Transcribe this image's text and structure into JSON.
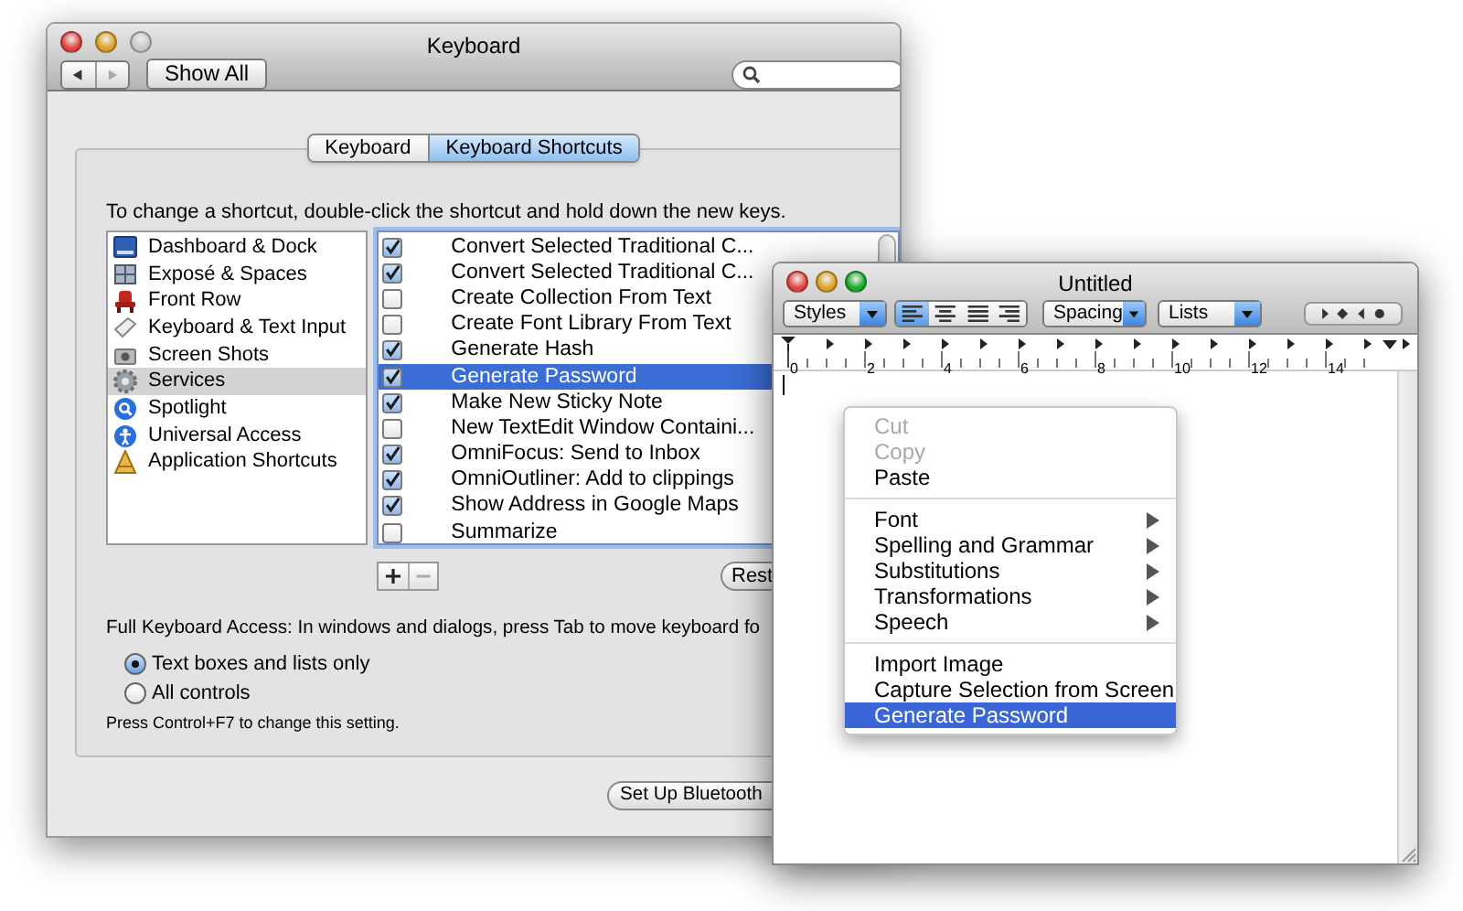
{
  "keyboard_window": {
    "title": "Keyboard",
    "show_all_button": "Show All",
    "tabs": [
      {
        "label": "Keyboard",
        "selected": false
      },
      {
        "label": "Keyboard Shortcuts",
        "selected": true
      }
    ],
    "instructions": "To change a shortcut, double-click the shortcut and hold down the new keys.",
    "categories": [
      {
        "label": "Dashboard & Dock",
        "selected": false
      },
      {
        "label": "Exposé & Spaces",
        "selected": false
      },
      {
        "label": "Front Row",
        "selected": false
      },
      {
        "label": "Keyboard & Text Input",
        "selected": false
      },
      {
        "label": "Screen Shots",
        "selected": false
      },
      {
        "label": "Services",
        "selected": true
      },
      {
        "label": "Spotlight",
        "selected": false
      },
      {
        "label": "Universal Access",
        "selected": false
      },
      {
        "label": "Application Shortcuts",
        "selected": false
      }
    ],
    "services": [
      {
        "label": "Convert Selected Traditional C...",
        "checked": true,
        "selected": false
      },
      {
        "label": "Convert Selected Traditional C...",
        "checked": true,
        "selected": false
      },
      {
        "label": "Create Collection From Text",
        "checked": false,
        "selected": false
      },
      {
        "label": "Create Font Library From Text",
        "checked": false,
        "selected": false
      },
      {
        "label": "Generate Hash",
        "checked": true,
        "selected": false
      },
      {
        "label": "Generate Password",
        "checked": true,
        "selected": true
      },
      {
        "label": "Make New Sticky Note",
        "checked": true,
        "selected": false
      },
      {
        "label": "New TextEdit Window Containi...",
        "checked": false,
        "selected": false
      },
      {
        "label": "OmniFocus: Send to Inbox",
        "checked": true,
        "selected": false
      },
      {
        "label": "OmniOutliner: Add to clippings",
        "checked": true,
        "selected": false
      },
      {
        "label": "Show Address in Google Maps",
        "checked": true,
        "selected": false
      },
      {
        "label": "Summarize",
        "checked": false,
        "selected": false
      }
    ],
    "restore_button": "Rest",
    "full_keyboard_access": "Full Keyboard Access: In windows and dialogs, press Tab to move keyboard fo",
    "access_options": [
      {
        "label": "Text boxes and lists only",
        "selected": true
      },
      {
        "label": "All controls",
        "selected": false
      }
    ],
    "note": "Press Control+F7 to change this setting.",
    "bluetooth_button": "Set Up Bluetooth"
  },
  "textedit_window": {
    "title": "Untitled",
    "styles_popup": "Styles",
    "alignment": [
      {
        "kind": "left",
        "selected": true
      },
      {
        "kind": "center",
        "selected": false
      },
      {
        "kind": "justify",
        "selected": false
      },
      {
        "kind": "right",
        "selected": false
      }
    ],
    "spacing_popup": "Spacing",
    "lists_popup": "Lists",
    "ruler_labels": [
      "0",
      "2",
      "4",
      "6",
      "8",
      "10",
      "12",
      "14"
    ],
    "context_menu": [
      {
        "kind": "item",
        "label": "Cut",
        "disabled": true,
        "submenu": false,
        "selected": false
      },
      {
        "kind": "item",
        "label": "Copy",
        "disabled": true,
        "submenu": false,
        "selected": false
      },
      {
        "kind": "item",
        "label": "Paste",
        "disabled": false,
        "submenu": false,
        "selected": false
      },
      {
        "kind": "separator"
      },
      {
        "kind": "item",
        "label": "Font",
        "disabled": false,
        "submenu": true,
        "selected": false
      },
      {
        "kind": "item",
        "label": "Spelling and Grammar",
        "disabled": false,
        "submenu": true,
        "selected": false
      },
      {
        "kind": "item",
        "label": "Substitutions",
        "disabled": false,
        "submenu": true,
        "selected": false
      },
      {
        "kind": "item",
        "label": "Transformations",
        "disabled": false,
        "submenu": true,
        "selected": false
      },
      {
        "kind": "item",
        "label": "Speech",
        "disabled": false,
        "submenu": true,
        "selected": false
      },
      {
        "kind": "separator"
      },
      {
        "kind": "item",
        "label": "Import Image",
        "disabled": false,
        "submenu": false,
        "selected": false
      },
      {
        "kind": "item",
        "label": "Capture Selection from Screen",
        "disabled": false,
        "submenu": false,
        "selected": false
      },
      {
        "kind": "item",
        "label": "Generate Password",
        "disabled": false,
        "submenu": false,
        "selected": true
      }
    ]
  }
}
